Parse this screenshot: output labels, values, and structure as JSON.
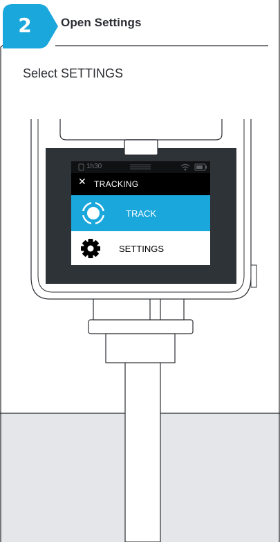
{
  "step": {
    "number": "2",
    "title": "Open Settings"
  },
  "instruction": "Select SETTINGS",
  "device": {
    "status_bar": {
      "time": "1h30",
      "icons": [
        "sd-card-icon",
        "wifi-icon",
        "battery-icon"
      ]
    },
    "header": {
      "label": "TRACKING",
      "icon": "close-icon"
    },
    "menu": [
      {
        "label": "TRACK",
        "icon": "target-icon",
        "selected": true
      },
      {
        "label": "SETTINGS",
        "icon": "gear-icon",
        "selected": false
      }
    ]
  },
  "colors": {
    "accent": "#1aa7dc",
    "dark_text": "#2b2d33",
    "screen_bezel": "#2e3338",
    "ground": "#e4e6e9"
  }
}
